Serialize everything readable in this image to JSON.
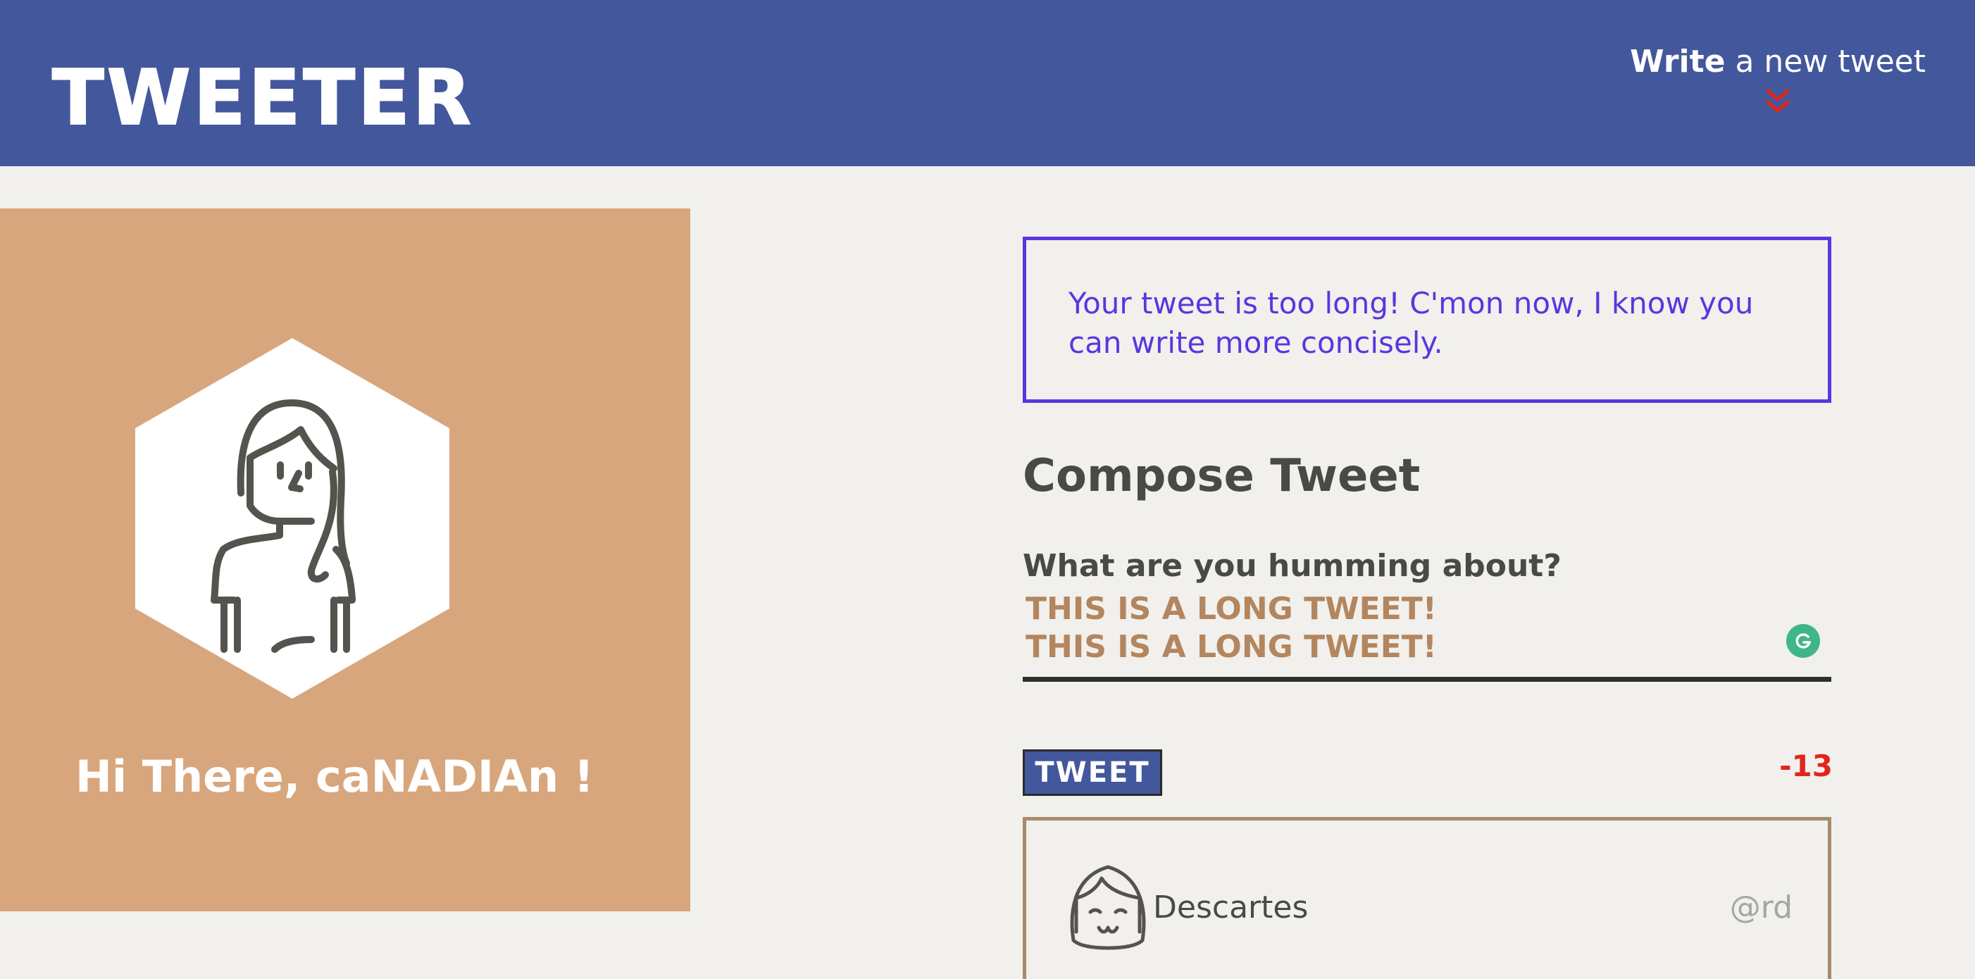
{
  "header": {
    "logo": "TWEETER",
    "write_strong": "Write",
    "write_rest": " a new tweet",
    "nav_icon": "double-chevron-down-icon",
    "accent_color": "#e3241b",
    "background_color": "#43579c"
  },
  "profile": {
    "greeting": "Hi There, caNADIAn !",
    "avatar_icon": "woman-avatar-icon",
    "background_color": "#d8a67c"
  },
  "error": {
    "message": "Your tweet is too long! C'mon now, I know you can write more concisely.",
    "color": "#5b35e0"
  },
  "compose": {
    "title": "Compose Tweet",
    "prompt": "What are you humming about?",
    "value": "THIS IS A LONG TWEET!\nTHIS IS A LONG TWEET!",
    "button_label": "TWEET",
    "counter": "-13",
    "counter_color": "#e3241b",
    "assistant_icon": "grammarly-icon"
  },
  "tweets": [
    {
      "name": "Descartes",
      "handle": "@rd",
      "avatar_icon": "girl-avatar-icon"
    }
  ]
}
